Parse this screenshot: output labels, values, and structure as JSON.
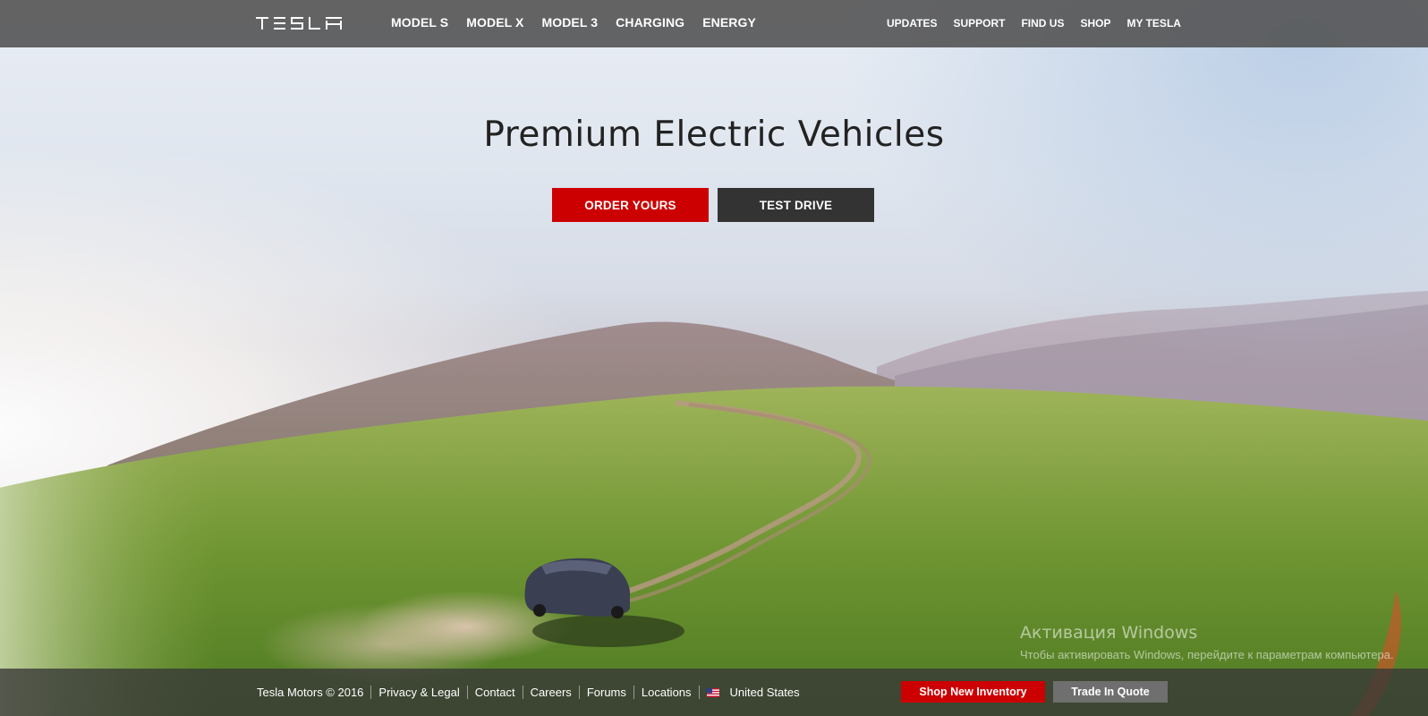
{
  "brand": {
    "logo_text": "TESLA"
  },
  "nav": {
    "main": [
      "MODEL S",
      "MODEL X",
      "MODEL 3",
      "CHARGING",
      "ENERGY"
    ],
    "util": [
      "UPDATES",
      "SUPPORT",
      "FIND US",
      "SHOP",
      "MY TESLA"
    ]
  },
  "hero": {
    "headline": "Premium Electric Vehicles",
    "order_label": "ORDER YOURS",
    "drive_label": "TEST DRIVE"
  },
  "watermark": {
    "title": "Активация Windows",
    "body": "Чтобы активировать Windows, перейдите к параметрам компьютера."
  },
  "footer": {
    "copyright": "Tesla Motors © 2016",
    "links": [
      "Privacy & Legal",
      "Contact",
      "Careers",
      "Forums",
      "Locations"
    ],
    "region": "United States",
    "shop_label": "Shop New Inventory",
    "trade_label": "Trade In Quote"
  },
  "colors": {
    "accent": "#cc0000",
    "dark_button": "#333333",
    "nav_bg": "#505050"
  }
}
